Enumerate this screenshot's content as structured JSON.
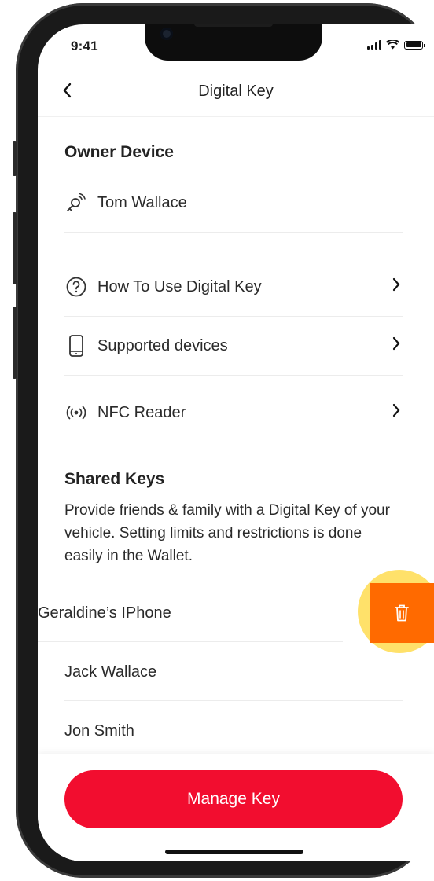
{
  "status_bar": {
    "time": "9:41"
  },
  "nav": {
    "title": "Digital Key",
    "back_icon": "chevron-left-icon"
  },
  "owner": {
    "section_title": "Owner Device",
    "device_name": "Tom Wallace",
    "icon": "key-signal-icon"
  },
  "menu": [
    {
      "label": "How To Use Digital Key",
      "icon": "question-circle-icon"
    },
    {
      "label": "Supported devices",
      "icon": "phone-icon"
    },
    {
      "label": "NFC Reader",
      "icon": "nfc-icon"
    }
  ],
  "shared_keys": {
    "section_title": "Shared Keys",
    "description": "Provide friends & family with a Digital Key of your vehicle. Setting limits and restrictions is done easily in the Wallet.",
    "items": [
      {
        "name": "Geraldine’s IPhone"
      },
      {
        "name": "Jack Wallace"
      },
      {
        "name": "Jon Smith"
      }
    ],
    "delete_icon": "trash-icon"
  },
  "footer": {
    "manage_label": "Manage Key"
  },
  "colors": {
    "primary": "#f20d2f",
    "delete": "#ff6a00",
    "highlight": "#ffde5a"
  }
}
